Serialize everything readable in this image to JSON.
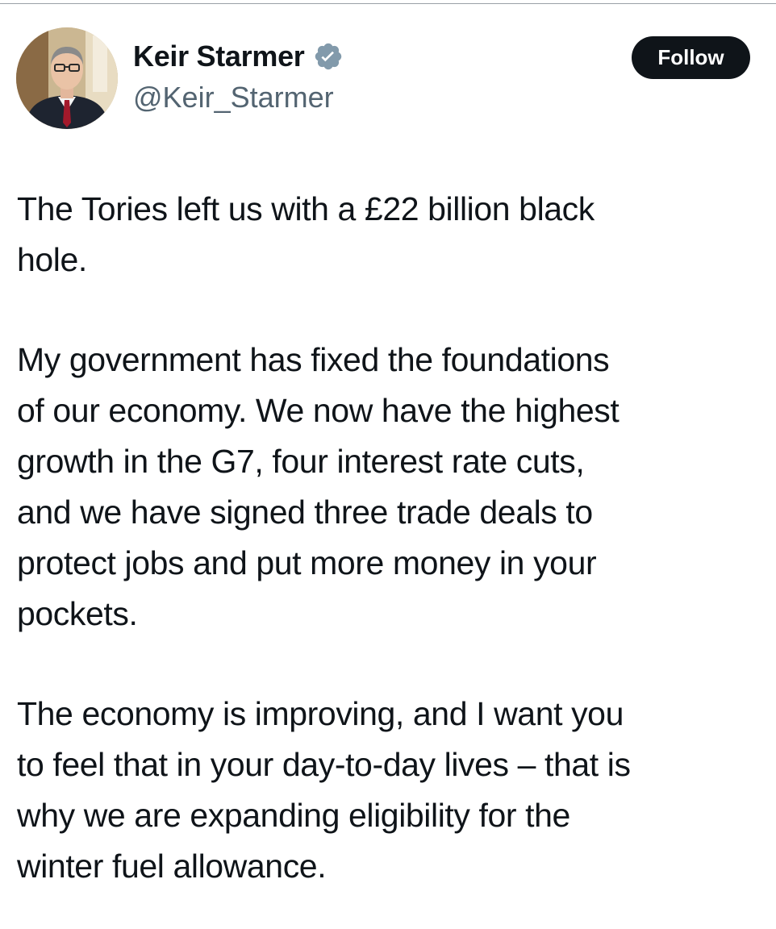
{
  "author": {
    "display_name": "Keir Starmer",
    "handle": "@Keir_Starmer",
    "verified": true,
    "avatar_icon": "profile-photo",
    "verified_icon": "verified-badge-icon",
    "badge_color": "#829aab"
  },
  "actions": {
    "follow_label": "Follow"
  },
  "tweet": {
    "paragraphs": [
      "The Tories left us with a £22 billion black\nhole.",
      "My government has fixed the foundations\nof our economy. We now have the highest\ngrowth in the G7, four interest rate cuts,\nand we have signed three trade deals to\nprotect jobs and put more money in your\npockets.",
      "The economy is improving, and I want you\nto feel that in your day-to-day lives – that is\nwhy we are expanding eligibility for the\nwinter fuel allowance."
    ]
  }
}
